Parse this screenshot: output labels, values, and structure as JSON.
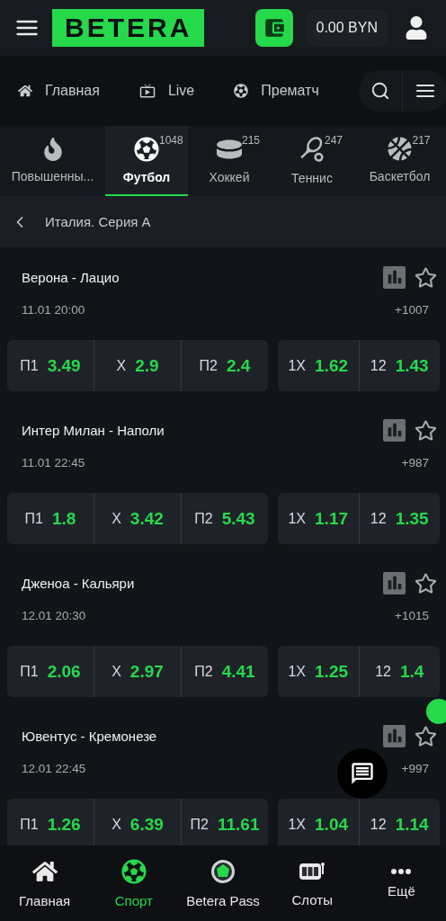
{
  "header": {
    "logo": "BETERA",
    "balance": "0.00 BYN"
  },
  "nav": [
    {
      "kind": "home",
      "label": "Главная"
    },
    {
      "kind": "live",
      "label": "Live"
    },
    {
      "kind": "prematch",
      "label": "Прематч"
    }
  ],
  "sports": [
    {
      "kind": "boosted",
      "label": "Повышенны...",
      "selected": false
    },
    {
      "kind": "football",
      "label": "Футбол",
      "count": "1048",
      "selected": true
    },
    {
      "kind": "hockey",
      "label": "Хоккей",
      "count": "215",
      "selected": false
    },
    {
      "kind": "tennis",
      "label": "Теннис",
      "count": "247",
      "selected": false
    },
    {
      "kind": "basketball",
      "label": "Баскетбол",
      "count": "217",
      "selected": false
    }
  ],
  "breadcrumb": "Италия. Серия A",
  "matches": [
    {
      "teams": "Верона - Лацио",
      "time": "11.01 20:00",
      "markets": "+1007",
      "odds": [
        [
          {
            "label": "П1",
            "value": "3.49"
          },
          {
            "label": "X",
            "value": "2.9"
          },
          {
            "label": "П2",
            "value": "2.4"
          }
        ],
        [
          {
            "label": "1X",
            "value": "1.62"
          },
          {
            "label": "12",
            "value": "1.43"
          }
        ]
      ]
    },
    {
      "teams": "Интер Милан - Наполи",
      "time": "11.01 22:45",
      "markets": "+987",
      "odds": [
        [
          {
            "label": "П1",
            "value": "1.8"
          },
          {
            "label": "X",
            "value": "3.42"
          },
          {
            "label": "П2",
            "value": "5.43"
          }
        ],
        [
          {
            "label": "1X",
            "value": "1.17"
          },
          {
            "label": "12",
            "value": "1.35"
          }
        ]
      ]
    },
    {
      "teams": "Дженоа - Кальяри",
      "time": "12.01 20:30",
      "markets": "+1015",
      "odds": [
        [
          {
            "label": "П1",
            "value": "2.06"
          },
          {
            "label": "X",
            "value": "2.97"
          },
          {
            "label": "П2",
            "value": "4.41"
          }
        ],
        [
          {
            "label": "1X",
            "value": "1.25"
          },
          {
            "label": "12",
            "value": "1.4"
          }
        ]
      ]
    },
    {
      "teams": "Ювентус - Кремонезе",
      "time": "12.01 22:45",
      "markets": "+997",
      "odds": [
        [
          {
            "label": "П1",
            "value": "1.26"
          },
          {
            "label": "X",
            "value": "6.39"
          },
          {
            "label": "П2",
            "value": "11.61"
          }
        ],
        [
          {
            "label": "1X",
            "value": "1.04"
          },
          {
            "label": "12",
            "value": "1.14"
          }
        ]
      ]
    }
  ],
  "bottom_nav": [
    {
      "kind": "home",
      "label": "Главная",
      "selected": false
    },
    {
      "kind": "sport",
      "label": "Спорт",
      "selected": true
    },
    {
      "kind": "pass",
      "label": "Betera Pass",
      "selected": false
    },
    {
      "kind": "slots",
      "label": "Слоты",
      "selected": false
    },
    {
      "kind": "more",
      "label": "Ещё",
      "selected": false
    }
  ]
}
